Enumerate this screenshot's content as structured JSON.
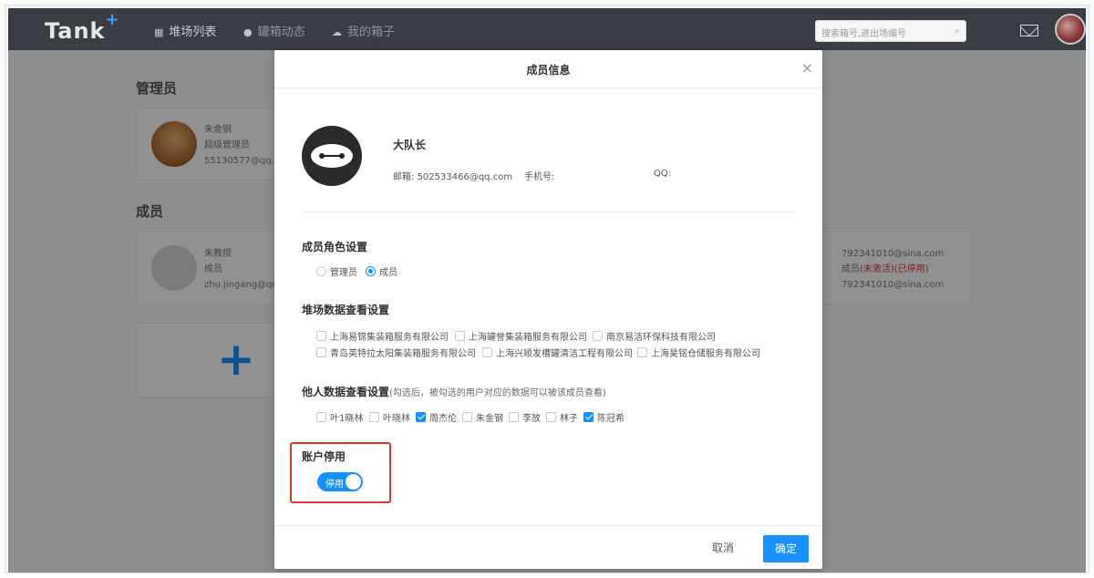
{
  "nav": {
    "logo": "Tank",
    "logo_plus": "+",
    "items": [
      {
        "icon": "grid-icon",
        "label": "堆场列表"
      },
      {
        "icon": "circle-icon",
        "label": "罐箱动态"
      },
      {
        "icon": "cloud-icon",
        "label": "我的箱子"
      }
    ],
    "search_placeholder": "搜索箱号,进出场编号"
  },
  "background": {
    "admins_title": "管理员",
    "admin": {
      "name": "朱金钢",
      "role": "超级管理员",
      "email": "55130577@qq.co"
    },
    "members_title": "成员",
    "member": {
      "name": "朱教授",
      "role": "成员",
      "email": "zhu.jingang@qq.co"
    },
    "right_member": {
      "line1": "792341010@sina.com",
      "line2_prefix": "成员",
      "line2_status": "(未激活)(已停用)",
      "line3": "792341010@sina.com"
    },
    "add_symbol": "+"
  },
  "modal": {
    "title": "成员信息",
    "close": "×",
    "profile": {
      "name": "大队长",
      "email_label": "邮箱:",
      "email": "502533466@qq.com",
      "phone_label": "手机号:",
      "qq_label": "QQ:"
    },
    "role_section": {
      "title": "成员角色设置",
      "options": [
        {
          "label": "管理员",
          "selected": false
        },
        {
          "label": "成员",
          "selected": true
        }
      ]
    },
    "yard_section": {
      "title": "堆场数据查看设置",
      "rows": [
        [
          {
            "label": "上海易锦集装箱服务有限公司",
            "checked": false
          },
          {
            "label": "上海罐誉集装箱服务有限公司",
            "checked": false
          },
          {
            "label": "南京易洁环保科技有限公司",
            "checked": false
          }
        ],
        [
          {
            "label": "青岛英特拉太阳集装箱服务有限公司",
            "checked": false
          },
          {
            "label": "上海兴顺发槽罐清洁工程有限公司",
            "checked": false
          },
          {
            "label": "上海昊铭仓储服务有限公司",
            "checked": false
          }
        ]
      ]
    },
    "others_section": {
      "title": "他人数据查看设置",
      "hint": "(勾选后，被勾选的用户对应的数据可以被该成员查看)",
      "users": [
        {
          "label": "叶1晓林",
          "checked": false
        },
        {
          "label": "叶晓林",
          "checked": false
        },
        {
          "label": "周杰伦",
          "checked": true
        },
        {
          "label": "朱金钢",
          "checked": false
        },
        {
          "label": "李放",
          "checked": false
        },
        {
          "label": "林子",
          "checked": false
        },
        {
          "label": "陈冠希",
          "checked": true
        }
      ]
    },
    "disable_section": {
      "title": "账户停用",
      "toggle_label": "停用",
      "toggle_on": true
    },
    "footer": {
      "cancel": "取消",
      "confirm": "确定"
    }
  },
  "colors": {
    "primary": "#1890ff",
    "nav_bg": "#3a3d44",
    "highlight": "#e3342f",
    "status_red": "#d9363e"
  }
}
